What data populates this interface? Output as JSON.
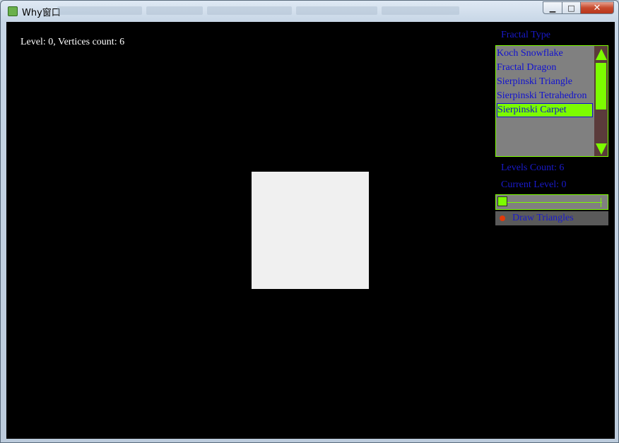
{
  "window": {
    "title": "Why窗口",
    "minimize_glyph": "▁",
    "maximize_glyph": "□",
    "close_glyph": "✕"
  },
  "canvas": {
    "status": "Level: 0, Vertices count: 6"
  },
  "panel": {
    "fractal_type_label": "Fractal Type",
    "fractal_types": [
      "Koch Snowflake",
      "Fractal Dragon",
      "Sierpinski Triangle",
      "Sierpinski Tetrahedron",
      "Sierpinski Carpet"
    ],
    "selected_index": 4,
    "levels_count_label": "Levels Count: 6",
    "current_level_label": "Current Level: 0",
    "current_level_fraction": 0,
    "draw_triangles_label": "Draw Triangles",
    "draw_triangles_checked": true
  },
  "colors": {
    "accent_green": "#7cfc00",
    "label_blue": "#1a1acc",
    "canvas_background": "#000000",
    "shape_fill": "#f0f0f0",
    "toggle_dot": "#e23a0a"
  }
}
